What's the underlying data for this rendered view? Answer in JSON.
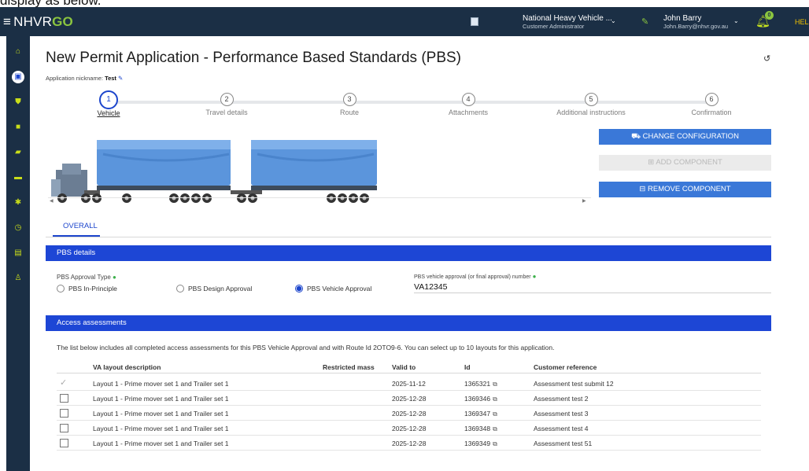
{
  "caption": "display as below.",
  "topbar": {
    "menu_icon": "hamburger-menu-icon",
    "brand_main": "NHVR",
    "brand_go": "GO",
    "org_name": "National Heavy Vehicle ...",
    "org_role": "Customer Administrator",
    "user_name": "John Barry",
    "user_email": "John.Barry@nhvr.gov.au",
    "notification_count": "0",
    "help_label": "HEL"
  },
  "sidebar": {
    "items": [
      "home-icon",
      "applications-icon",
      "shield-icon",
      "briefcase-icon",
      "truck-icon",
      "vehicle-icon",
      "settings-icon",
      "clock-icon",
      "id-card-icon",
      "users-icon"
    ],
    "active_index": 1
  },
  "page": {
    "title": "New Permit Application - Performance Based Standards (PBS)",
    "nickname_label": "Application nickname:",
    "nickname_value": "Test"
  },
  "steps": [
    {
      "num": "1",
      "label": "Vehicle"
    },
    {
      "num": "2",
      "label": "Travel details"
    },
    {
      "num": "3",
      "label": "Route"
    },
    {
      "num": "4",
      "label": "Attachments"
    },
    {
      "num": "5",
      "label": "Additional instructions"
    },
    {
      "num": "6",
      "label": "Confirmation"
    }
  ],
  "active_step": 1,
  "buttons": {
    "change_configuration": "CHANGE CONFIGURATION",
    "add_component": "ADD COMPONENT",
    "remove_component": "REMOVE COMPONENT"
  },
  "tabs": {
    "overall": "OVERALL"
  },
  "pbs": {
    "section_title": "PBS details",
    "approval_type_label": "PBS Approval Type",
    "options": [
      "PBS In-Principle",
      "PBS Design Approval",
      "PBS Vehicle Approval"
    ],
    "selected_option": "PBS Vehicle Approval",
    "va_number_label": "PBS vehicle approval (or final approval) number",
    "va_number_value": "VA12345"
  },
  "access": {
    "section_title": "Access assessments",
    "description": "The list below includes all completed access assessments for this PBS Vehicle Approval and with Route Id 2OTO9-6. You can select up to 10 layouts for this application.",
    "columns": [
      "VA layout description",
      "Restricted mass",
      "Valid to",
      "Id",
      "Customer reference"
    ],
    "rows": [
      {
        "checked": true,
        "layout": "Layout 1 - Prime mover set 1 and Trailer set 1",
        "restricted_mass": "",
        "valid_to": "2025-11-12",
        "id": "1365321",
        "reference": "Assessment test submit 12"
      },
      {
        "checked": false,
        "layout": "Layout 1 - Prime mover set 1 and Trailer set 1",
        "restricted_mass": "",
        "valid_to": "2025-12-28",
        "id": "1369346",
        "reference": "Assessment test 2"
      },
      {
        "checked": false,
        "layout": "Layout 1 - Prime mover set 1 and Trailer set 1",
        "restricted_mass": "",
        "valid_to": "2025-12-28",
        "id": "1369347",
        "reference": "Assessment test 3"
      },
      {
        "checked": false,
        "layout": "Layout 1 - Prime mover set 1 and Trailer set 1",
        "restricted_mass": "",
        "valid_to": "2025-12-28",
        "id": "1369348",
        "reference": "Assessment test 4"
      },
      {
        "checked": false,
        "layout": "Layout 1 - Prime mover set 1 and Trailer set 1",
        "restricted_mass": "",
        "valid_to": "2025-12-28",
        "id": "1369349",
        "reference": "Assessment test 51"
      }
    ]
  },
  "colors": {
    "topbar": "#1b2f45",
    "primary_blue": "#1d46d5",
    "button_blue": "#3a78d8",
    "accent_green": "#8bc53f",
    "trailer_blue": "#5b95dc"
  }
}
